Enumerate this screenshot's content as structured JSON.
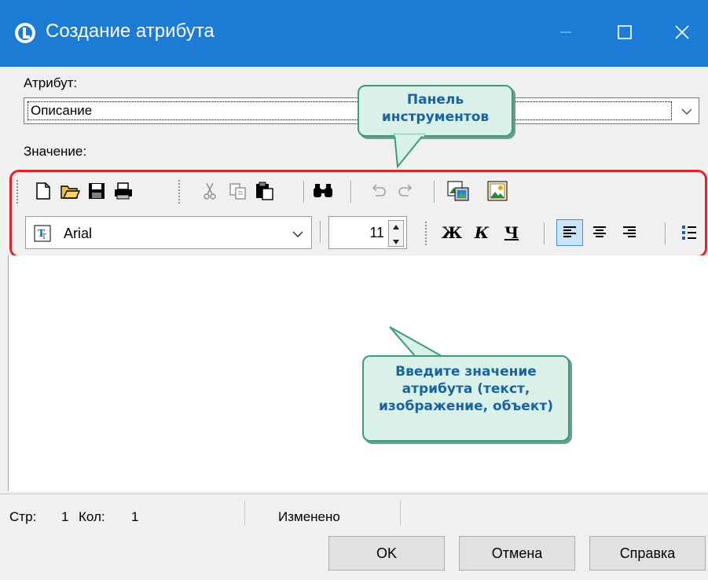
{
  "window": {
    "title": "Создание атрибута",
    "titlebar_color": "#1c7cd5",
    "controls": [
      "minimize-icon",
      "maximize-icon",
      "close-icon"
    ]
  },
  "attribute": {
    "label": "Атрибут:",
    "selected": "Описание"
  },
  "value_label": "Значение:",
  "toolbar1": {
    "icons": [
      "new-document-icon",
      "open-folder-icon",
      "save-icon",
      "print-icon",
      "cut-icon",
      "copy-icon",
      "paste-icon",
      "find-icon",
      "undo-icon",
      "redo-icon",
      "insert-object-icon",
      "insert-image-icon"
    ]
  },
  "toolbar2": {
    "font_name": "Arial",
    "font_size": "11",
    "bold_label": "Ж",
    "italic_label": "К",
    "underline_label": "Ч",
    "icons": [
      "font-truetype-icon",
      "align-left-icon",
      "align-center-icon",
      "align-right-icon",
      "bullet-list-icon"
    ]
  },
  "callouts": {
    "toolbar": "Панель инструментов",
    "editor": "Введите значение атрибута (текст, изображение, объект)"
  },
  "status": {
    "row_label": "Стр:",
    "row_value": "1",
    "col_label": "Кол:",
    "col_value": "1",
    "modified": "Изменено"
  },
  "buttons": {
    "ok": "OK",
    "cancel": "Отмена",
    "help": "Справка"
  },
  "colors": {
    "callout_fill": "#d9f1e9",
    "callout_border": "#3b9c78",
    "callout_text": "#1763a6",
    "highlight_frame": "#e8202a"
  }
}
